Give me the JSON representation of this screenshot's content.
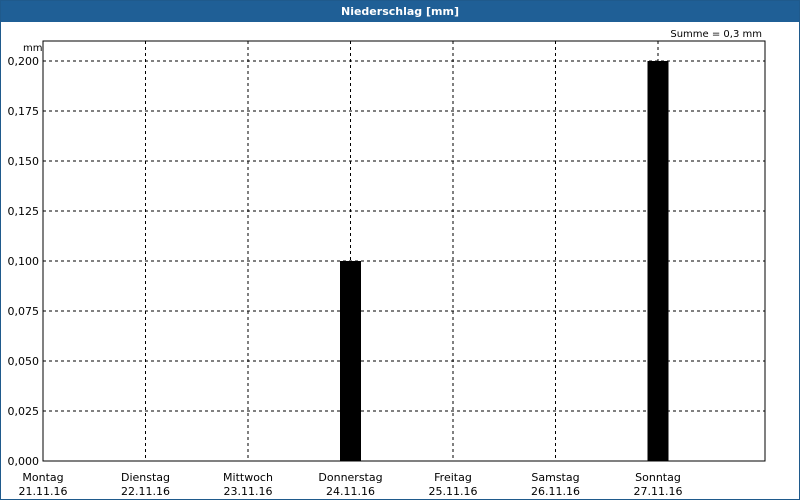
{
  "window": {
    "title": "Niederschlag [mm]"
  },
  "chart_data": {
    "type": "bar",
    "title": "Niederschlag [mm]",
    "ylabel": "mm",
    "ylim": [
      0,
      0.2
    ],
    "yticks": [
      "0,000",
      "0,025",
      "0,050",
      "0,075",
      "0,100",
      "0,125",
      "0,150",
      "0,175",
      "0,200"
    ],
    "categories": [
      {
        "day": "Montag",
        "date": "21.11.16"
      },
      {
        "day": "Dienstag",
        "date": "22.11.16"
      },
      {
        "day": "Mittwoch",
        "date": "23.11.16"
      },
      {
        "day": "Donnerstag",
        "date": "24.11.16"
      },
      {
        "day": "Freitag",
        "date": "25.11.16"
      },
      {
        "day": "Samstag",
        "date": "26.11.16"
      },
      {
        "day": "Sonntag",
        "date": "27.11.16"
      }
    ],
    "bars": [
      {
        "category_index": 3,
        "value": 0.1
      },
      {
        "category_index": 6,
        "value": 0.2
      }
    ],
    "annotation": "Summe = 0,3 mm",
    "grid": true,
    "bar_color": "#000000"
  }
}
